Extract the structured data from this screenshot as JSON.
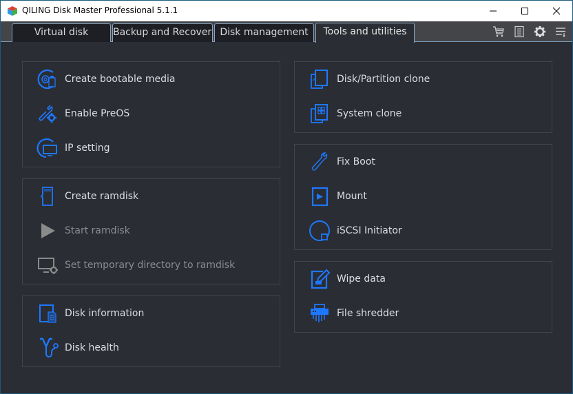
{
  "window": {
    "title": "QILING Disk Master Professional 5.1.1",
    "controls": [
      "minimize",
      "maximize",
      "close"
    ]
  },
  "tabs": [
    {
      "label": "Virtual disk",
      "active": false
    },
    {
      "label": "Backup and Recovery",
      "active": false
    },
    {
      "label": "Disk management",
      "active": false
    },
    {
      "label": "Tools and utilities",
      "active": true
    }
  ],
  "toolbar": {
    "icons": [
      "cart-icon",
      "log-icon",
      "settings-gear-icon",
      "menu-icon"
    ]
  },
  "colors": {
    "accent": "#1e78ff",
    "background": "#2a2d33",
    "text": "#dadde3",
    "disabled_text": "#8a8c90"
  },
  "panels": {
    "boot": {
      "items": [
        {
          "label": "Create bootable media",
          "icon": "bootable-media-icon",
          "enabled": true
        },
        {
          "label": "Enable PreOS",
          "icon": "tools-gear-icon",
          "enabled": true
        },
        {
          "label": "IP setting",
          "icon": "ip-monitor-icon",
          "enabled": true
        }
      ]
    },
    "ramdisk": {
      "items": [
        {
          "label": "Create ramdisk",
          "icon": "sd-card-icon",
          "enabled": true
        },
        {
          "label": "Start ramdisk",
          "icon": "play-icon",
          "enabled": false
        },
        {
          "label": "Set temporary directory to ramdisk",
          "icon": "monitor-gear-icon",
          "enabled": false
        }
      ]
    },
    "disk": {
      "items": [
        {
          "label": "Disk information",
          "icon": "disk-info-icon",
          "enabled": true
        },
        {
          "label": "Disk health",
          "icon": "stethoscope-icon",
          "enabled": true
        }
      ]
    },
    "clone": {
      "items": [
        {
          "label": "Disk/Partition clone",
          "icon": "disk-clone-icon",
          "enabled": true
        },
        {
          "label": "System clone",
          "icon": "system-clone-icon",
          "enabled": true
        }
      ]
    },
    "repair": {
      "items": [
        {
          "label": "Fix Boot",
          "icon": "wrench-icon",
          "enabled": true
        },
        {
          "label": "Mount",
          "icon": "mount-play-icon",
          "enabled": true
        },
        {
          "label": "iSCSI Initiator",
          "icon": "iscsi-icon",
          "enabled": true
        }
      ]
    },
    "wipe": {
      "items": [
        {
          "label": "Wipe data",
          "icon": "wipe-edit-icon",
          "enabled": true
        },
        {
          "label": "File shredder",
          "icon": "shredder-icon",
          "enabled": true
        }
      ]
    }
  }
}
